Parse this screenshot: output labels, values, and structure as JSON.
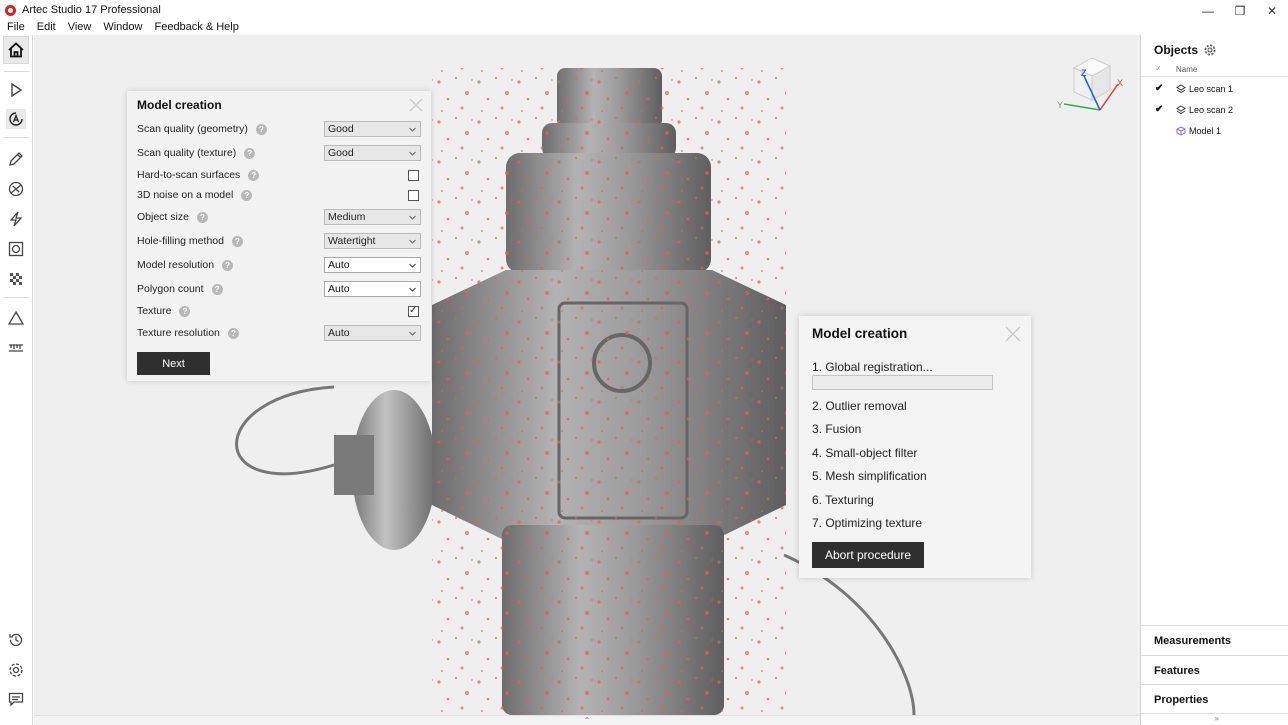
{
  "window": {
    "title": "Artec Studio 17 Professional",
    "minimize_glyph": "—",
    "restore_glyph": "❐",
    "close_glyph": "✕"
  },
  "menu": {
    "items": [
      "File",
      "Edit",
      "View",
      "Window",
      "Feedback & Help"
    ]
  },
  "left_toolbar": {
    "tools": [
      "home-icon",
      "play-icon",
      "autopilot-icon",
      "pencil-icon",
      "registration-icon",
      "lightning-icon",
      "fusion-icon",
      "texture-checker-icon",
      "triangle-icon",
      "ruler-icon",
      "history-icon",
      "settings-icon",
      "chat-icon"
    ]
  },
  "settings_dialog": {
    "title": "Model creation",
    "rows": [
      {
        "label": "Scan quality (geometry)",
        "type": "select",
        "value": "Good",
        "disabled": true
      },
      {
        "label": "Scan quality (texture)",
        "type": "select",
        "value": "Good",
        "disabled": true
      },
      {
        "label": "Hard-to-scan surfaces",
        "type": "checkbox",
        "checked": false
      },
      {
        "label": "3D noise on a model",
        "type": "checkbox",
        "checked": false
      },
      {
        "label": "Object size",
        "type": "select",
        "value": "Medium",
        "disabled": true
      },
      {
        "label": "Hole-filling method",
        "type": "select",
        "value": "Watertight",
        "disabled": true
      },
      {
        "label": "Model resolution",
        "type": "select",
        "value": "Auto",
        "disabled": false
      },
      {
        "label": "Polygon count",
        "type": "select",
        "value": "Auto",
        "disabled": false
      },
      {
        "label": "Texture",
        "type": "checkbox",
        "checked": true
      },
      {
        "label": "Texture resolution",
        "type": "select",
        "value": "Auto",
        "disabled": true
      }
    ],
    "help_glyph": "?",
    "check_glyph": "✓",
    "next_label": "Next"
  },
  "progress_dialog": {
    "title": "Model creation",
    "steps": [
      "1. Global registration...",
      "2. Outlier removal",
      "3. Fusion",
      "4. Small-object filter",
      "5. Mesh simplification",
      "6. Texturing",
      "7. Optimizing texture"
    ],
    "progress": 0.0,
    "abort_label": "Abort procedure"
  },
  "view_cube": {
    "axis_x": "X",
    "axis_y": "Y",
    "axis_z": "Z"
  },
  "objects_panel": {
    "title": "Objects",
    "col_name": "Name",
    "col_check": "✓",
    "items": [
      {
        "name": "Leo scan 1",
        "checked": true,
        "type": "scan"
      },
      {
        "name": "Leo scan 2",
        "checked": true,
        "type": "scan"
      },
      {
        "name": "Model 1",
        "checked": false,
        "type": "model"
      }
    ],
    "check_glyph": "✔",
    "sections": [
      "Measurements",
      "Features",
      "Properties"
    ]
  },
  "colors": {
    "accent": "#d9251d",
    "dark_button": "#2f2f2f",
    "model_purple": "#8a6fd1",
    "hydrant_gray": "#8e8e8e",
    "overlay_red": "#e2604e"
  }
}
